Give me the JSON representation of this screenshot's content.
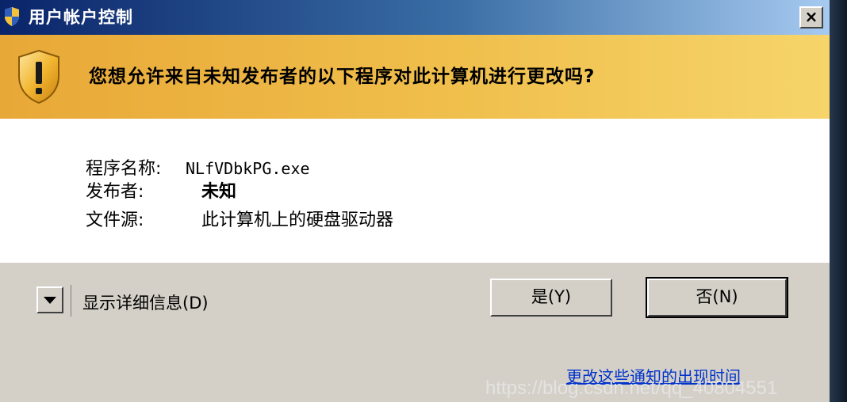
{
  "window": {
    "title": "用户帐户控制",
    "close_label": "×"
  },
  "banner": {
    "question": "您想允许来自未知发布者的以下程序对此计算机进行更改吗?"
  },
  "info": {
    "program_label": "程序名称:",
    "program_value": "NLfVDbkPG.exe",
    "publisher_label": "发布者:",
    "publisher_value": "未知",
    "source_label": "文件源:",
    "source_value": "此计算机上的硬盘驱动器"
  },
  "footer": {
    "details_label": "显示详细信息(D)",
    "yes_label": "是(Y)",
    "no_label": "否(N)",
    "notify_link": "更改这些通知的出现时间"
  },
  "watermark": "https://blog.csdn.net/qq_40804551",
  "icons": {
    "title_icon": "uac-shield-icon",
    "banner_icon": "warning-shield-icon",
    "details_icon": "chevron-down-icon"
  },
  "colors": {
    "banner_start": "#e8a837",
    "banner_end": "#f6d46a",
    "title_start": "#0a246a",
    "title_end": "#a6caf0",
    "link": "#0033cc"
  }
}
